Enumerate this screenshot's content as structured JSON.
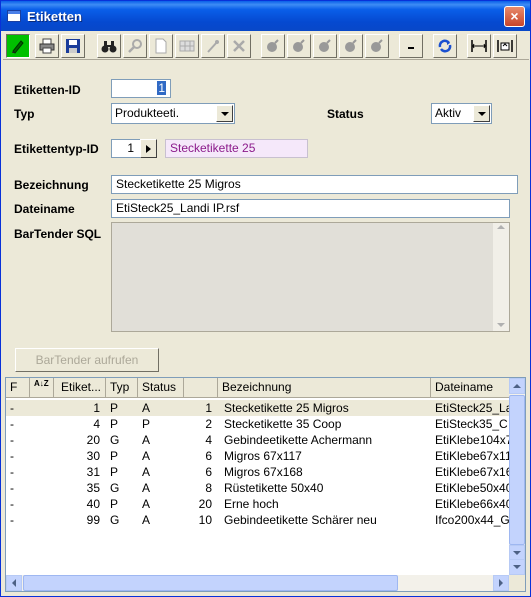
{
  "window": {
    "title": "Etiketten",
    "close": "×"
  },
  "toolbar": {
    "icons": [
      "pencil-icon",
      "print-icon",
      "save-icon",
      "binoculars-icon",
      "magnifier-icon",
      "new-document-icon",
      "grid-icon",
      "stamp-icon",
      "delete-icon",
      "bomb-icon",
      "bomb-icon-2",
      "bomb-icon-3",
      "bomb-icon-4",
      "bomb-icon-5",
      "minus-icon",
      "refresh-icon",
      "arrows-in-icon",
      "arrows-out-icon"
    ]
  },
  "form": {
    "etiketten_id_label": "Etiketten-ID",
    "etiketten_id_value": "1",
    "typ_label": "Typ",
    "typ_value": "Produkteeti.",
    "status_label": "Status",
    "status_value": "Aktiv",
    "etikettentyp_label": "Etikettentyp-ID",
    "etikettentyp_value": "1",
    "etikettentyp_name": "Stecketikette 25",
    "bezeichnung_label": "Bezeichnung",
    "bezeichnung_value": "Stecketikette 25 Migros",
    "dateiname_label": "Dateiname",
    "dateiname_value": "EtiSteck25_Landi IP.rsf",
    "sql_label": "BarTender SQL",
    "sql_value": "",
    "bartender_button": "BarTender aufrufen"
  },
  "grid": {
    "headers": {
      "f": "F",
      "sort": "A↓Z",
      "etiket": "Etiket...",
      "typ": "Typ",
      "status": "Status",
      "num": "",
      "bez": "Bezeichnung",
      "datei": "Dateiname"
    },
    "rows": [
      {
        "f": "-",
        "id": "1",
        "typ": "P",
        "status": "A",
        "num": "1",
        "bez": "Stecketikette 25 Migros",
        "datei": "EtiSteck25_La"
      },
      {
        "f": "-",
        "id": "4",
        "typ": "P",
        "status": "P",
        "num": "2",
        "bez": "Stecketikette 35 Coop",
        "datei": "EtiSteck35_C"
      },
      {
        "f": "-",
        "id": "20",
        "typ": "G",
        "status": "A",
        "num": "4",
        "bez": "Gebindeetikette Achermann",
        "datei": "EtiKlebe104x7"
      },
      {
        "f": "-",
        "id": "30",
        "typ": "P",
        "status": "A",
        "num": "6",
        "bez": "Migros 67x117",
        "datei": "EtiKlebe67x11"
      },
      {
        "f": "-",
        "id": "31",
        "typ": "P",
        "status": "A",
        "num": "6",
        "bez": "Migros 67x168",
        "datei": "EtiKlebe67x16"
      },
      {
        "f": "-",
        "id": "35",
        "typ": "G",
        "status": "A",
        "num": "8",
        "bez": "Rüstetikette 50x40",
        "datei": "EtiKlebe50x40"
      },
      {
        "f": "-",
        "id": "40",
        "typ": "P",
        "status": "A",
        "num": "20",
        "bez": "Erne hoch",
        "datei": "EtiKlebe66x40"
      },
      {
        "f": "-",
        "id": "99",
        "typ": "G",
        "status": "A",
        "num": "10",
        "bez": "Gebindeetikette Schärer neu",
        "datei": "Ifco200x44_G"
      }
    ]
  },
  "colors": {
    "title_bar": "#0a5fe9",
    "active_tool": "#00c000",
    "etikettentyp_name_bg": "#f5e8fa",
    "etikettentyp_name_fg": "#8b1a8b"
  }
}
